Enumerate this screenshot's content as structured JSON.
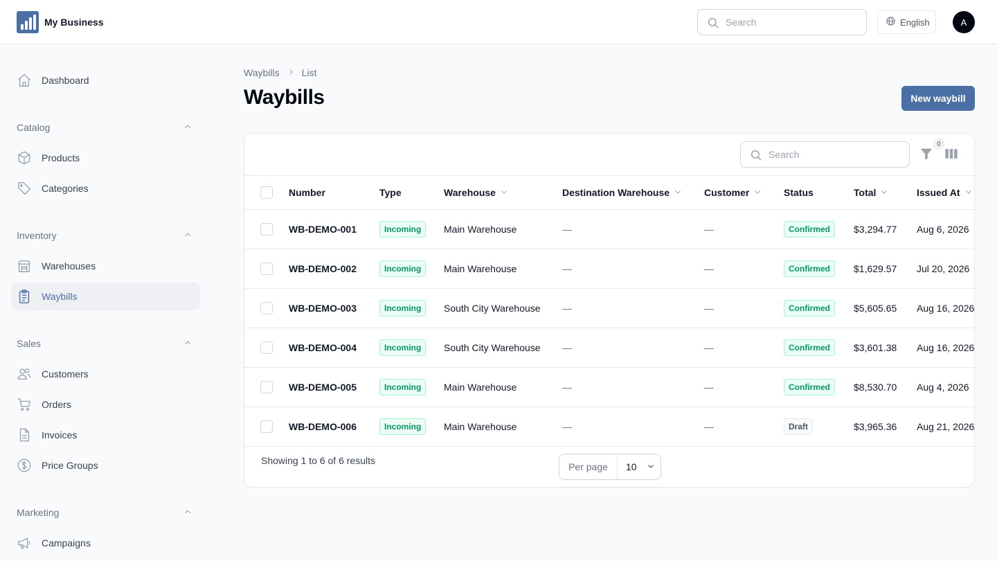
{
  "app": {
    "brand_name": "My Business",
    "accent_color": "#4a6fa5"
  },
  "topbar": {
    "search_placeholder": "Search",
    "language": "English",
    "avatar_initial": "A"
  },
  "sidebar": {
    "dashboard": "Dashboard",
    "groups": {
      "catalog": {
        "label": "Catalog",
        "items": [
          "Products",
          "Categories"
        ]
      },
      "inventory": {
        "label": "Inventory",
        "items": [
          "Warehouses",
          "Waybills"
        ]
      },
      "sales": {
        "label": "Sales",
        "items": [
          "Customers",
          "Orders",
          "Invoices",
          "Price Groups"
        ]
      },
      "marketing": {
        "label": "Marketing",
        "items": [
          "Campaigns"
        ]
      }
    },
    "active_item": "Waybills"
  },
  "breadcrumb": [
    "Waybills",
    "List"
  ],
  "page": {
    "title": "Waybills",
    "new_button": "New waybill"
  },
  "table": {
    "search_placeholder": "Search",
    "filter_count": "0",
    "columns": [
      "Number",
      "Type",
      "Warehouse",
      "Destination Warehouse",
      "Customer",
      "Status",
      "Total",
      "Issued At"
    ],
    "rows": [
      {
        "number": "WB-DEMO-001",
        "type": "Incoming",
        "warehouse": "Main Warehouse",
        "destination": "—",
        "customer": "—",
        "status": "Confirmed",
        "total": "$3,294.77",
        "issued_at": "Aug 6, 2026"
      },
      {
        "number": "WB-DEMO-002",
        "type": "Incoming",
        "warehouse": "Main Warehouse",
        "destination": "—",
        "customer": "—",
        "status": "Confirmed",
        "total": "$1,629.57",
        "issued_at": "Jul 20, 2026"
      },
      {
        "number": "WB-DEMO-003",
        "type": "Incoming",
        "warehouse": "South City Warehouse",
        "destination": "—",
        "customer": "—",
        "status": "Confirmed",
        "total": "$5,605.65",
        "issued_at": "Aug 16, 2026"
      },
      {
        "number": "WB-DEMO-004",
        "type": "Incoming",
        "warehouse": "South City Warehouse",
        "destination": "—",
        "customer": "—",
        "status": "Confirmed",
        "total": "$3,601.38",
        "issued_at": "Aug 16, 2026"
      },
      {
        "number": "WB-DEMO-005",
        "type": "Incoming",
        "warehouse": "Main Warehouse",
        "destination": "—",
        "customer": "—",
        "status": "Confirmed",
        "total": "$8,530.70",
        "issued_at": "Aug 4, 2026"
      },
      {
        "number": "WB-DEMO-006",
        "type": "Incoming",
        "warehouse": "Main Warehouse",
        "destination": "—",
        "customer": "—",
        "status": "Draft",
        "total": "$3,965.36",
        "issued_at": "Aug 21, 2026"
      }
    ],
    "footer": {
      "showing": "Showing 1 to 6 of 6 results",
      "per_page_label": "Per page",
      "per_page_value": "10"
    }
  }
}
